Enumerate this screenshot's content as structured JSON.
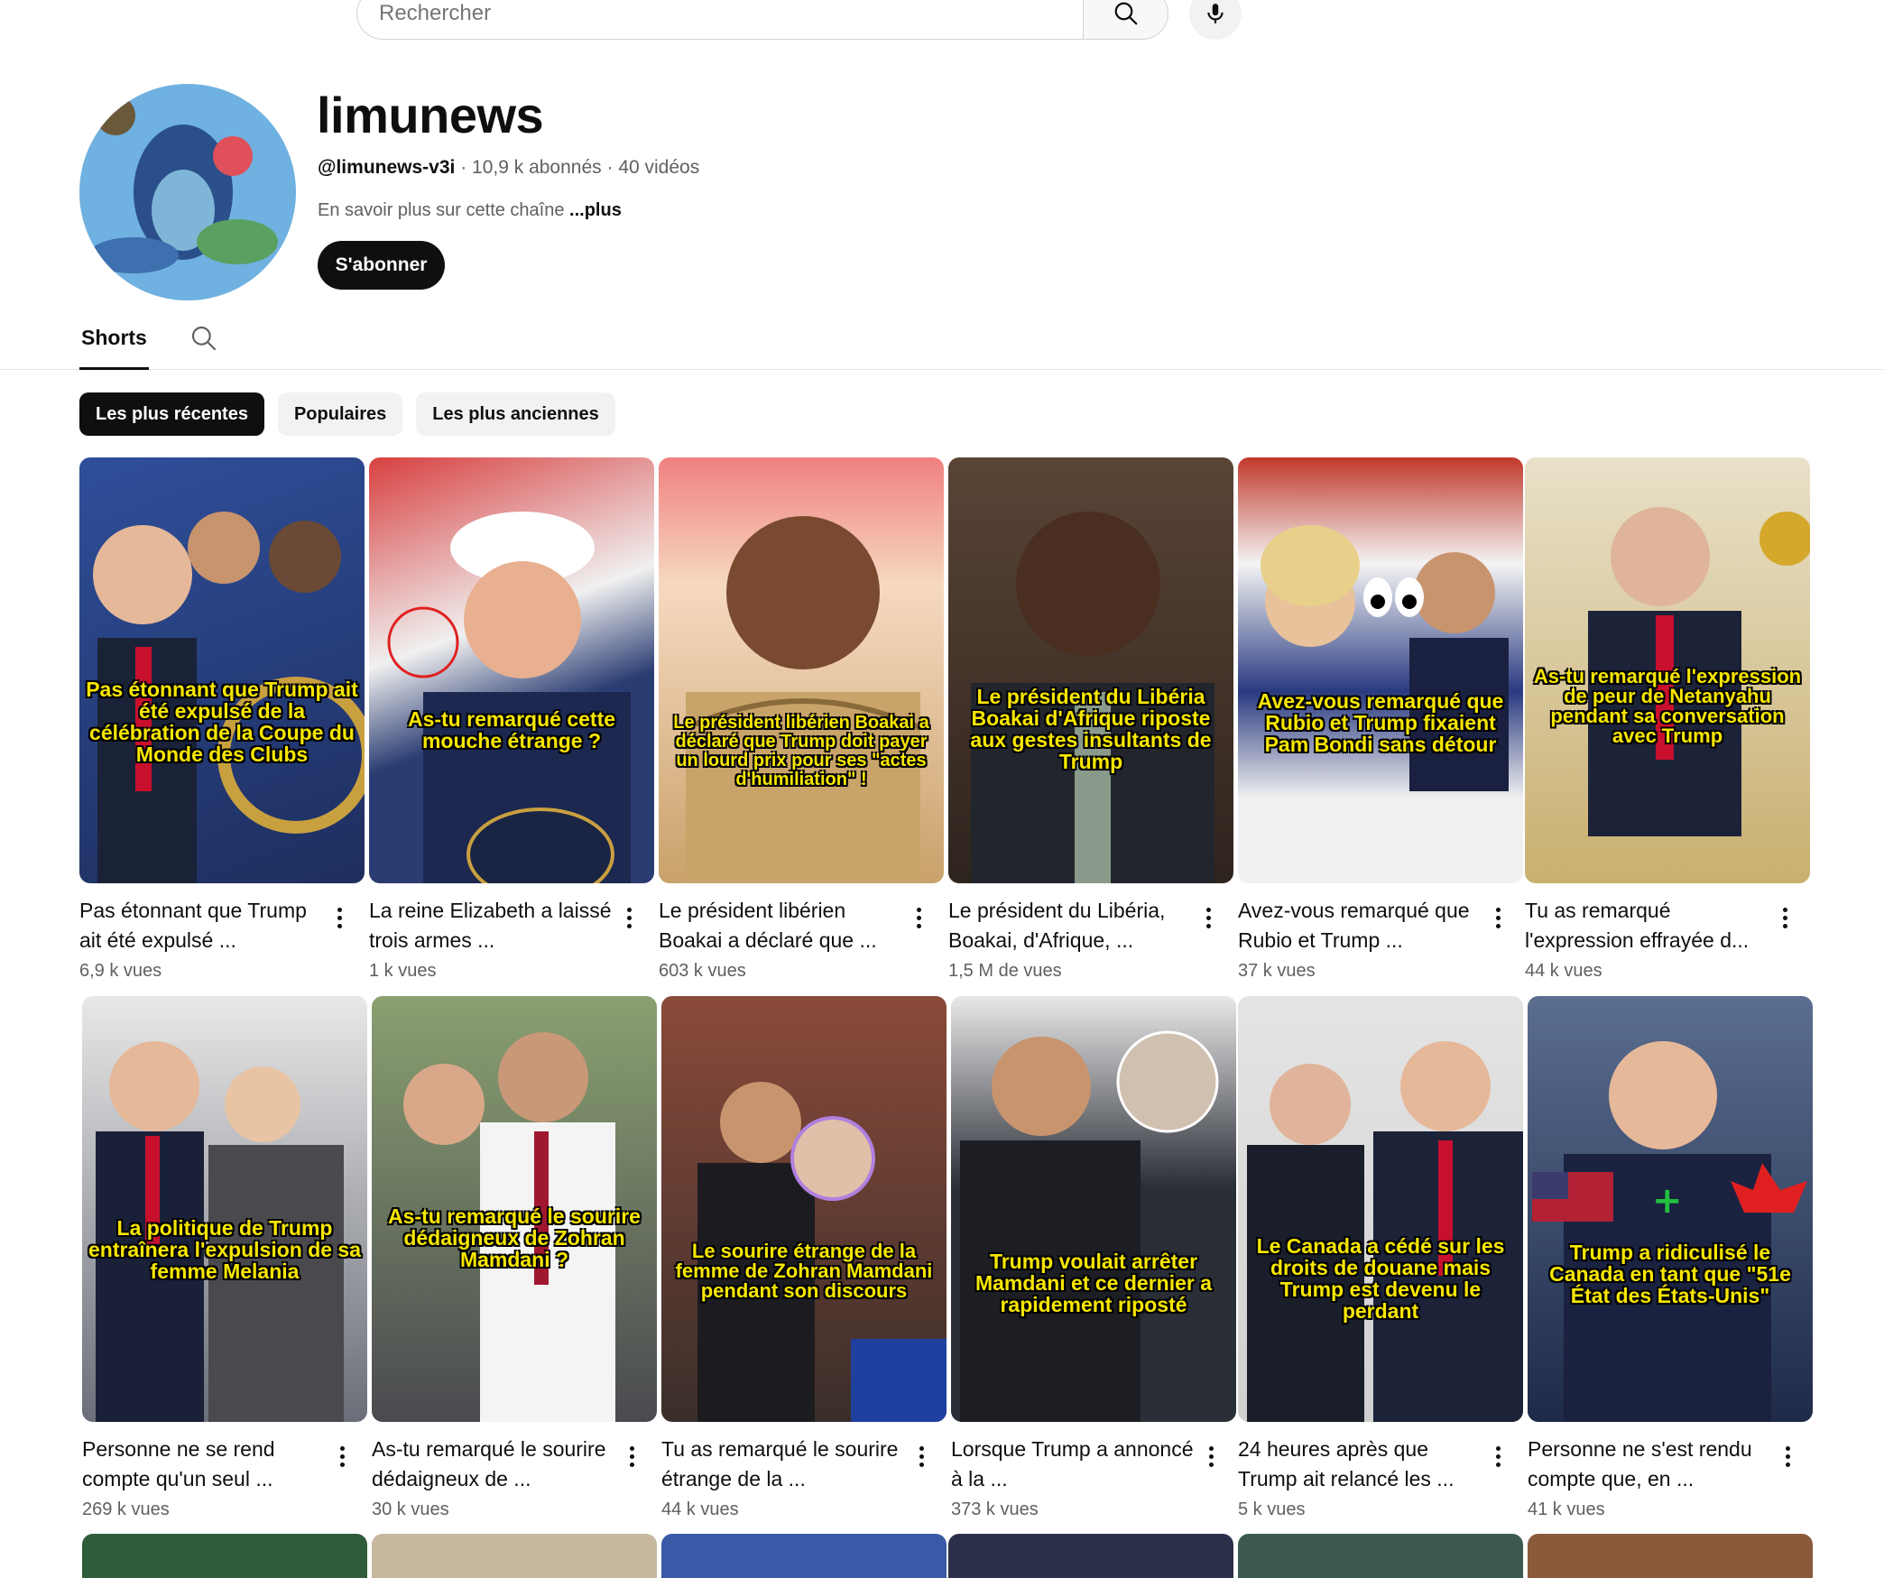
{
  "search": {
    "placeholder": "Rechercher"
  },
  "channel": {
    "name": "limunews",
    "handle": "@limunews-v3i",
    "subscribers": "10,9 k abonnés",
    "videos": "40 vidéos",
    "about": "En savoir plus sur cette chaîne",
    "about_more": "...plus",
    "subscribe_label": "S'abonner"
  },
  "tabs": {
    "shorts": "Shorts"
  },
  "chips": [
    "Les plus récentes",
    "Populaires",
    "Les plus anciennes"
  ],
  "row1": [
    {
      "caption": "Pas étonnant que Trump ait été expulsé de la célébration de la Coupe du Monde des Clubs",
      "title": "Pas étonnant que Trump ait été expulsé ...",
      "views": "6,9 k vues",
      "bg": "#3b5aa0"
    },
    {
      "caption": "As-tu remarqué cette mouche étrange ?",
      "title": "La reine Elizabeth a laissé trois armes ...",
      "views": "1 k vues",
      "bg": "#2b3f73"
    },
    {
      "caption": "Le président libérien Boakai a déclaré que Trump doit payer un lourd prix pour ses \"actes d'humiliation\" !",
      "title": "Le président libérien Boakai a déclaré que ...",
      "views": "603 k vues",
      "bg": "#c9a26a"
    },
    {
      "caption": "Le président du Libéria Boakai d'Afrique riposte aux gestes insultants de Trump",
      "title": "Le président du Libéria, Boakai, d'Afrique, ...",
      "views": "1,5 M de vues",
      "bg": "#4a3a30"
    },
    {
      "caption": "Avez-vous remarqué que Rubio et Trump fixaient Pam Bondi sans détour",
      "title": "Avez-vous remarqué que Rubio et Trump ...",
      "views": "37 k vues",
      "bg": "#283a8a"
    },
    {
      "caption": "As-tu remarqué l'expression de peur de Netanyahu pendant sa conversation avec Trump",
      "title": "Tu as remarqué l'expression effrayée d...",
      "views": "44 k vues",
      "bg": "#b79a55"
    }
  ],
  "row2": [
    {
      "caption": "La politique de Trump entraînera l'expulsion de sa femme Melania",
      "title": "Personne ne se rend compte qu'un seul ...",
      "views": "269 k vues",
      "bg": "#3a3f4a"
    },
    {
      "caption": "As-tu remarqué le sourire dédaigneux de Zohran Mamdani ?",
      "title": "As-tu remarqué le sourire dédaigneux de ...",
      "views": "30 k vues",
      "bg": "#6b7a5a"
    },
    {
      "caption": "Le sourire étrange de la femme de Zohran Mamdani pendant son discours",
      "title": "Tu as remarqué le sourire étrange de la ...",
      "views": "44 k vues",
      "bg": "#5a4a3a"
    },
    {
      "caption": "Trump voulait arrêter Mamdani et ce dernier a rapidement riposté",
      "title": "Lorsque Trump a annoncé à la ...",
      "views": "373 k vues",
      "bg": "#2a2e36"
    },
    {
      "caption": "Le Canada a cédé sur les droits de douane mais Trump est devenu le perdant",
      "title": "24 heures après que Trump ait relancé les ...",
      "views": "5 k vues",
      "bg": "#2f3540"
    },
    {
      "caption": "Trump a ridiculisé le Canada en tant que \"51e État des États-Unis\"",
      "title": "Personne ne s'est rendu compte que, en ...",
      "views": "41 k vues",
      "bg": "#2c3e66"
    }
  ],
  "row3_colors": [
    "#2f5c3a",
    "#c8b8a0",
    "#3a5aa8",
    "#2b2f4a",
    "#3c5a50",
    "#8a5a3a"
  ]
}
